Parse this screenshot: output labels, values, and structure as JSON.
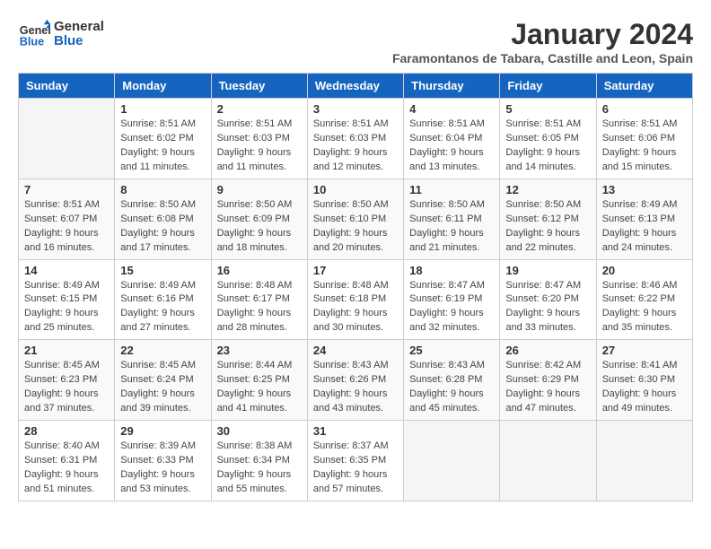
{
  "logo": {
    "general": "General",
    "blue": "Blue"
  },
  "title": "January 2024",
  "location": "Faramontanos de Tabara, Castille and Leon, Spain",
  "days_header": [
    "Sunday",
    "Monday",
    "Tuesday",
    "Wednesday",
    "Thursday",
    "Friday",
    "Saturday"
  ],
  "weeks": [
    [
      {
        "num": "",
        "info": ""
      },
      {
        "num": "1",
        "info": "Sunrise: 8:51 AM\nSunset: 6:02 PM\nDaylight: 9 hours\nand 11 minutes."
      },
      {
        "num": "2",
        "info": "Sunrise: 8:51 AM\nSunset: 6:03 PM\nDaylight: 9 hours\nand 11 minutes."
      },
      {
        "num": "3",
        "info": "Sunrise: 8:51 AM\nSunset: 6:03 PM\nDaylight: 9 hours\nand 12 minutes."
      },
      {
        "num": "4",
        "info": "Sunrise: 8:51 AM\nSunset: 6:04 PM\nDaylight: 9 hours\nand 13 minutes."
      },
      {
        "num": "5",
        "info": "Sunrise: 8:51 AM\nSunset: 6:05 PM\nDaylight: 9 hours\nand 14 minutes."
      },
      {
        "num": "6",
        "info": "Sunrise: 8:51 AM\nSunset: 6:06 PM\nDaylight: 9 hours\nand 15 minutes."
      }
    ],
    [
      {
        "num": "7",
        "info": "Sunrise: 8:51 AM\nSunset: 6:07 PM\nDaylight: 9 hours\nand 16 minutes."
      },
      {
        "num": "8",
        "info": "Sunrise: 8:50 AM\nSunset: 6:08 PM\nDaylight: 9 hours\nand 17 minutes."
      },
      {
        "num": "9",
        "info": "Sunrise: 8:50 AM\nSunset: 6:09 PM\nDaylight: 9 hours\nand 18 minutes."
      },
      {
        "num": "10",
        "info": "Sunrise: 8:50 AM\nSunset: 6:10 PM\nDaylight: 9 hours\nand 20 minutes."
      },
      {
        "num": "11",
        "info": "Sunrise: 8:50 AM\nSunset: 6:11 PM\nDaylight: 9 hours\nand 21 minutes."
      },
      {
        "num": "12",
        "info": "Sunrise: 8:50 AM\nSunset: 6:12 PM\nDaylight: 9 hours\nand 22 minutes."
      },
      {
        "num": "13",
        "info": "Sunrise: 8:49 AM\nSunset: 6:13 PM\nDaylight: 9 hours\nand 24 minutes."
      }
    ],
    [
      {
        "num": "14",
        "info": "Sunrise: 8:49 AM\nSunset: 6:15 PM\nDaylight: 9 hours\nand 25 minutes."
      },
      {
        "num": "15",
        "info": "Sunrise: 8:49 AM\nSunset: 6:16 PM\nDaylight: 9 hours\nand 27 minutes."
      },
      {
        "num": "16",
        "info": "Sunrise: 8:48 AM\nSunset: 6:17 PM\nDaylight: 9 hours\nand 28 minutes."
      },
      {
        "num": "17",
        "info": "Sunrise: 8:48 AM\nSunset: 6:18 PM\nDaylight: 9 hours\nand 30 minutes."
      },
      {
        "num": "18",
        "info": "Sunrise: 8:47 AM\nSunset: 6:19 PM\nDaylight: 9 hours\nand 32 minutes."
      },
      {
        "num": "19",
        "info": "Sunrise: 8:47 AM\nSunset: 6:20 PM\nDaylight: 9 hours\nand 33 minutes."
      },
      {
        "num": "20",
        "info": "Sunrise: 8:46 AM\nSunset: 6:22 PM\nDaylight: 9 hours\nand 35 minutes."
      }
    ],
    [
      {
        "num": "21",
        "info": "Sunrise: 8:45 AM\nSunset: 6:23 PM\nDaylight: 9 hours\nand 37 minutes."
      },
      {
        "num": "22",
        "info": "Sunrise: 8:45 AM\nSunset: 6:24 PM\nDaylight: 9 hours\nand 39 minutes."
      },
      {
        "num": "23",
        "info": "Sunrise: 8:44 AM\nSunset: 6:25 PM\nDaylight: 9 hours\nand 41 minutes."
      },
      {
        "num": "24",
        "info": "Sunrise: 8:43 AM\nSunset: 6:26 PM\nDaylight: 9 hours\nand 43 minutes."
      },
      {
        "num": "25",
        "info": "Sunrise: 8:43 AM\nSunset: 6:28 PM\nDaylight: 9 hours\nand 45 minutes."
      },
      {
        "num": "26",
        "info": "Sunrise: 8:42 AM\nSunset: 6:29 PM\nDaylight: 9 hours\nand 47 minutes."
      },
      {
        "num": "27",
        "info": "Sunrise: 8:41 AM\nSunset: 6:30 PM\nDaylight: 9 hours\nand 49 minutes."
      }
    ],
    [
      {
        "num": "28",
        "info": "Sunrise: 8:40 AM\nSunset: 6:31 PM\nDaylight: 9 hours\nand 51 minutes."
      },
      {
        "num": "29",
        "info": "Sunrise: 8:39 AM\nSunset: 6:33 PM\nDaylight: 9 hours\nand 53 minutes."
      },
      {
        "num": "30",
        "info": "Sunrise: 8:38 AM\nSunset: 6:34 PM\nDaylight: 9 hours\nand 55 minutes."
      },
      {
        "num": "31",
        "info": "Sunrise: 8:37 AM\nSunset: 6:35 PM\nDaylight: 9 hours\nand 57 minutes."
      },
      {
        "num": "",
        "info": ""
      },
      {
        "num": "",
        "info": ""
      },
      {
        "num": "",
        "info": ""
      }
    ]
  ]
}
